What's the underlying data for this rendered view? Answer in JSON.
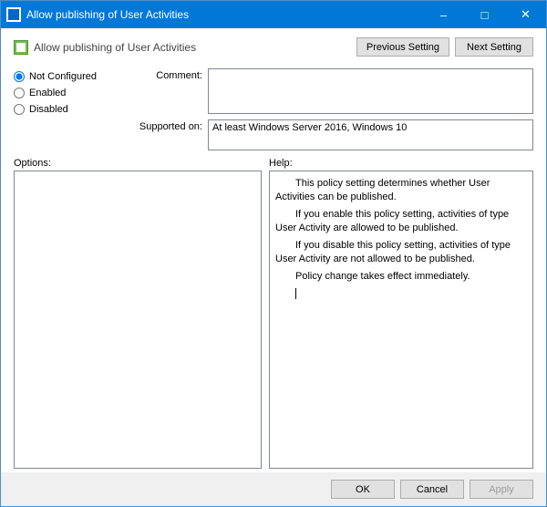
{
  "titlebar": {
    "title": "Allow publishing of User Activities"
  },
  "header": {
    "title": "Allow publishing of User Activities",
    "prev_label": "Previous Setting",
    "next_label": "Next Setting"
  },
  "config": {
    "radio": {
      "not_configured": "Not Configured",
      "enabled": "Enabled",
      "disabled": "Disabled",
      "selected": "not_configured"
    },
    "comment_label": "Comment:",
    "comment_value": "",
    "supported_label": "Supported on:",
    "supported_value": "At least Windows Server 2016, Windows 10"
  },
  "labels": {
    "options": "Options:",
    "help": "Help:"
  },
  "help": {
    "p1": "This policy setting determines whether User Activities can be published.",
    "p2": "If you enable this policy setting, activities of type User Activity are allowed to be published.",
    "p3": "If you disable this policy setting, activities of type User Activity are not allowed to be published.",
    "p4": "Policy change takes effect immediately."
  },
  "buttons": {
    "ok": "OK",
    "cancel": "Cancel",
    "apply": "Apply"
  }
}
